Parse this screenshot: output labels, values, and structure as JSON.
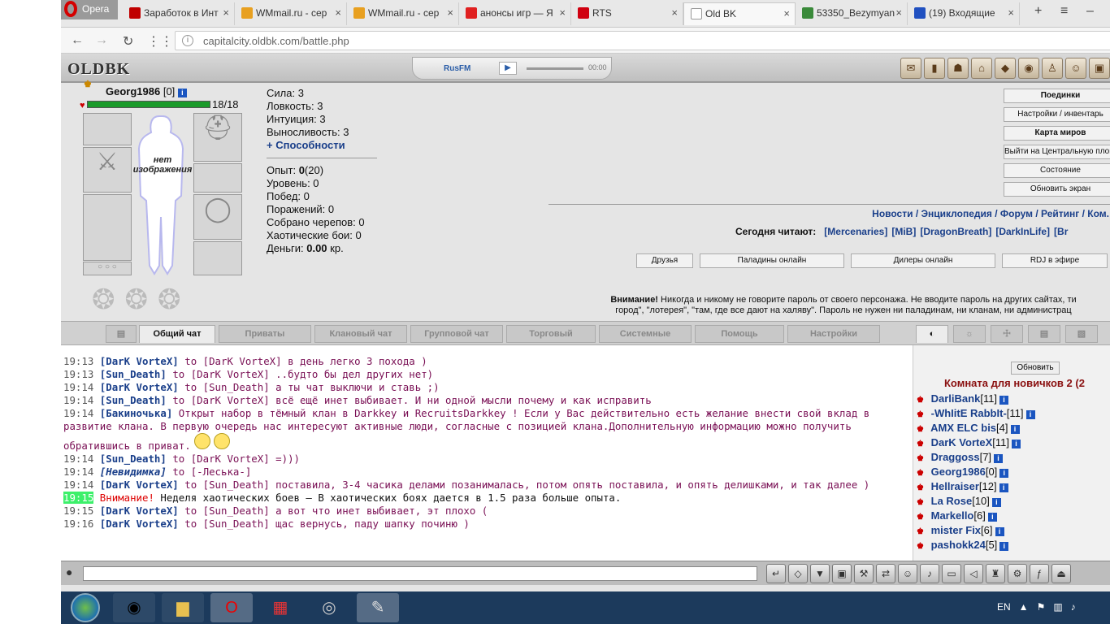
{
  "browser": {
    "opera_label": "Opera",
    "tabs": [
      {
        "title": "Заработок в Инт",
        "color": "#c00000"
      },
      {
        "title": "WMmail.ru - сер",
        "color": "#e8a020"
      },
      {
        "title": "WMmail.ru - сер",
        "color": "#e8a020"
      },
      {
        "title": "анонсы игр — Я",
        "color": "#e02020"
      },
      {
        "title": "RTS",
        "color": "#d00010"
      },
      {
        "title": "Old BK",
        "color": "#ffffff",
        "active": true
      },
      {
        "title": "53350_Bezymyan",
        "color": "#3a8a3a"
      },
      {
        "title": "(19) Входящие",
        "color": "#2050c0"
      }
    ],
    "url": "capitalcity.oldbk.com/battle.php"
  },
  "game": {
    "logo": "OLDBK",
    "radio_label": "RusFM",
    "radio_time": "00:00",
    "top_icons": [
      "ticon-1",
      "ticon-2",
      "ticon-3",
      "ticon-4",
      "ticon-5",
      "ticon-6",
      "ticon-7",
      "ticon-8",
      "ticon-9"
    ]
  },
  "character": {
    "name": "Georg1986",
    "level": "[0]",
    "hp": "18/18",
    "hp_fraction": 1.0,
    "no_image": "нет изображения",
    "stats": [
      {
        "label": "Сила:",
        "value": "3"
      },
      {
        "label": "Ловкость:",
        "value": "3"
      },
      {
        "label": "Интуиция:",
        "value": "3"
      },
      {
        "label": "Выносливость:",
        "value": "3"
      }
    ],
    "abilities": "+ Способности",
    "exp_label": "Опыт:",
    "exp_value": "0",
    "exp_next": "(20)",
    "level_label": "Уровень: 0",
    "wins": "Побед: 0",
    "losses": "Поражений: 0",
    "skulls": "Собрано черепов: 0",
    "chaos": "Хаотические бои: 0",
    "money_label": "Деньги:",
    "money_value": "0.00",
    "money_unit": "кр."
  },
  "right_buttons": [
    "Поединки",
    "Настройки / инвентарь",
    "Карта миров",
    "Выйти на Центральную площадь",
    "Состояние",
    "Обновить экран"
  ],
  "links": {
    "news": "Новости / Энциклопедия / Форум / Рейтинг / Ком.",
    "reading_label": "Сегодня читают:",
    "reading": [
      "[Mercenaries]",
      "[MiB]",
      "[DragonBreath]",
      "[DarkInLife]",
      "[Br"
    ]
  },
  "link_buttons": [
    "Друзья",
    "Паладины онлайн",
    "Дилеры онлайн",
    "RDJ в эфире"
  ],
  "warning": {
    "bold": "Внимание!",
    "line1": "Никогда и никому не говорите пароль от своего персонажа. Не вводите пароль на других сайтах, ти",
    "line2": "город\", \"лотерея\", \"там, где все дают на халяву\". Пароль не нужен ни паладинам, ни кланам, ни администрац"
  },
  "chat_tabs": [
    "Общий чат",
    "Приваты",
    "Клановый чат",
    "Групповой чат",
    "Торговый",
    "Системные",
    "Помощь",
    "Настройки"
  ],
  "chat": [
    {
      "time": "19:13",
      "nick": "[DarK VorteX]",
      "to": "to",
      "target": "[DarK VorteX]",
      "msg": "в день легко 3 похода )"
    },
    {
      "time": "19:13",
      "nick": "[Sun_Death]",
      "to": "to",
      "target": "[DarK VorteX]",
      "msg": "..будто бы дел других нет)"
    },
    {
      "time": "19:14",
      "nick": "[DarK VorteX]",
      "to": "to",
      "target": "[Sun_Death]",
      "msg": "а ты чат выключи и ставь ;)"
    },
    {
      "time": "19:14",
      "nick": "[Sun_Death]",
      "to": "to",
      "target": "[DarK VorteX]",
      "msg": "всё ещё инет выбивает. И ни одной мысли почему и как исправить"
    },
    {
      "time": "19:14",
      "nick": "[Бакиночька]",
      "msg": "Открыт набор в тёмный клан в Darkkey и RecruitsDarkkey ! Если у Вас действительно есть желание внести свой вклад в развитие клана. В первую очередь нас интересуют активные люди, согласные с позицией клана.Дополнительную информацию можно получить обратившись в приват."
    },
    {
      "time": "19:14",
      "nick": "[Sun_Death]",
      "to": "to",
      "target": "[DarK VorteX]",
      "msg": "=)))"
    },
    {
      "time": "19:14",
      "nick": "[Невидимка]",
      "to": "to",
      "target": "[-Леська-]",
      "msg": ""
    },
    {
      "time": "19:14",
      "nick": "[DarK VorteX]",
      "to": "to",
      "target": "[Sun_Death]",
      "msg": "поставила, 3-4 часика делами позанималась, потом опять поставила, и опять делишками, и так далее )"
    },
    {
      "time": "19:15",
      "alert": "Внимание!",
      "msg": "Неделя хаотических боев – В хаотических боях дается в 1.5 раза больше опыта."
    },
    {
      "time": "19:15",
      "nick": "[DarK VorteX]",
      "to": "to",
      "target": "[Sun_Death]",
      "msg": "а вот что инет выбивает, эт плохо ("
    },
    {
      "time": "19:16",
      "nick": "[DarK VorteX]",
      "to": "to",
      "target": "[Sun_Death]",
      "msg": "щас вернусь, паду шапку починю )"
    }
  ],
  "userlist": {
    "refresh": "Обновить",
    "room": "Комната для новичков 2 (2",
    "users": [
      {
        "name": "DarliBank",
        "level": "[11]"
      },
      {
        "name": "-WhIitE RabbIt-",
        "level": "[11]"
      },
      {
        "name": "AMX ELC bis",
        "level": "[4]"
      },
      {
        "name": "DarK VorteX",
        "level": "[11]"
      },
      {
        "name": "Draggoss",
        "level": "[7]"
      },
      {
        "name": "Georg1986",
        "level": "[0]"
      },
      {
        "name": "Hellraiser",
        "level": "[12]"
      },
      {
        "name": "La Rose",
        "level": "[10]"
      },
      {
        "name": "Markello",
        "level": "[6]"
      },
      {
        "name": "mister Fix",
        "level": "[6]"
      },
      {
        "name": "pashokk24",
        "level": "[5]"
      }
    ]
  },
  "taskbar": {
    "lang": "EN"
  }
}
